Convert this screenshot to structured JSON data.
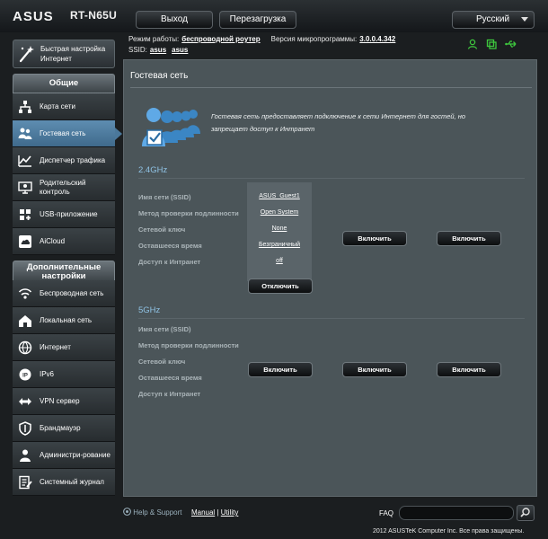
{
  "header": {
    "brand": "ASUS",
    "model": "RT-N65U",
    "logout": "Выход",
    "reboot": "Перезагрузка",
    "language": "Русский"
  },
  "status": {
    "mode_label": "Режим работы:",
    "mode_value": "беспроводной роутер",
    "fw_label": "Версия микропрограммы:",
    "fw_value": "3.0.0.4.342",
    "ssid_label": "SSID:",
    "ssid_1": "asus",
    "ssid_2": "asus",
    "icons": [
      "user-icon",
      "usb-device-icon",
      "usb-icon"
    ]
  },
  "quick_setup": {
    "label_line1": "Быстрая настройка",
    "label_line2": "Интернет"
  },
  "nav_general": {
    "title": "Общие",
    "items": [
      {
        "label": "Карта сети",
        "icon": "network-map-icon"
      },
      {
        "label": "Гостевая сеть",
        "icon": "guest-network-icon",
        "active": true
      },
      {
        "label": "Диспетчер трафика",
        "icon": "traffic-manager-icon"
      },
      {
        "label": "Родительский контроль",
        "icon": "parental-control-icon"
      },
      {
        "label": "USB-приложение",
        "icon": "usb-app-icon"
      },
      {
        "label": "AiCloud",
        "icon": "aicloud-icon"
      }
    ]
  },
  "nav_advanced": {
    "title": "Дополнительные настройки",
    "items": [
      {
        "label": "Беспроводная сеть",
        "icon": "wireless-icon"
      },
      {
        "label": "Локальная сеть",
        "icon": "lan-icon"
      },
      {
        "label": "Интернет",
        "icon": "globe-icon"
      },
      {
        "label": "IPv6",
        "icon": "ipv6-icon"
      },
      {
        "label": "VPN сервер",
        "icon": "vpn-icon"
      },
      {
        "label": "Брандмауэр",
        "icon": "firewall-icon"
      },
      {
        "label": "Администри-рование",
        "icon": "admin-icon"
      },
      {
        "label": "Системный журнал",
        "icon": "syslog-icon"
      }
    ]
  },
  "main": {
    "title": "Гостевая сеть",
    "description": "Гостевая сеть предоставляет подключение к сети Интернет для гостей, но запрещает доступ к Интранет",
    "field_labels": [
      "Имя сети (SSID)",
      "Метод проверки подлинности",
      "Сетевой ключ",
      "Оставшееся время",
      "Доступ к Интранет"
    ],
    "band_24": {
      "title": "2.4GHz",
      "guest1": {
        "ssid": "ASUS_Guest1",
        "auth": "Open System",
        "key": "None",
        "time": "Безграничный",
        "intranet": "off",
        "button": "Отключить"
      },
      "enable_button": "Включить"
    },
    "band_5": {
      "title": "5GHz",
      "enable_button": "Включить"
    }
  },
  "footer": {
    "help": "Help & Support",
    "manual": "Manual",
    "separator": "|",
    "utility": "Utility",
    "faq": "FAQ",
    "copyright": "2012 ASUSTeK Computer Inc. Все права защищены."
  },
  "colors": {
    "accent_blue": "#4b789b",
    "band_title": "#8fc2e4",
    "status_green": "#3ec83e"
  }
}
